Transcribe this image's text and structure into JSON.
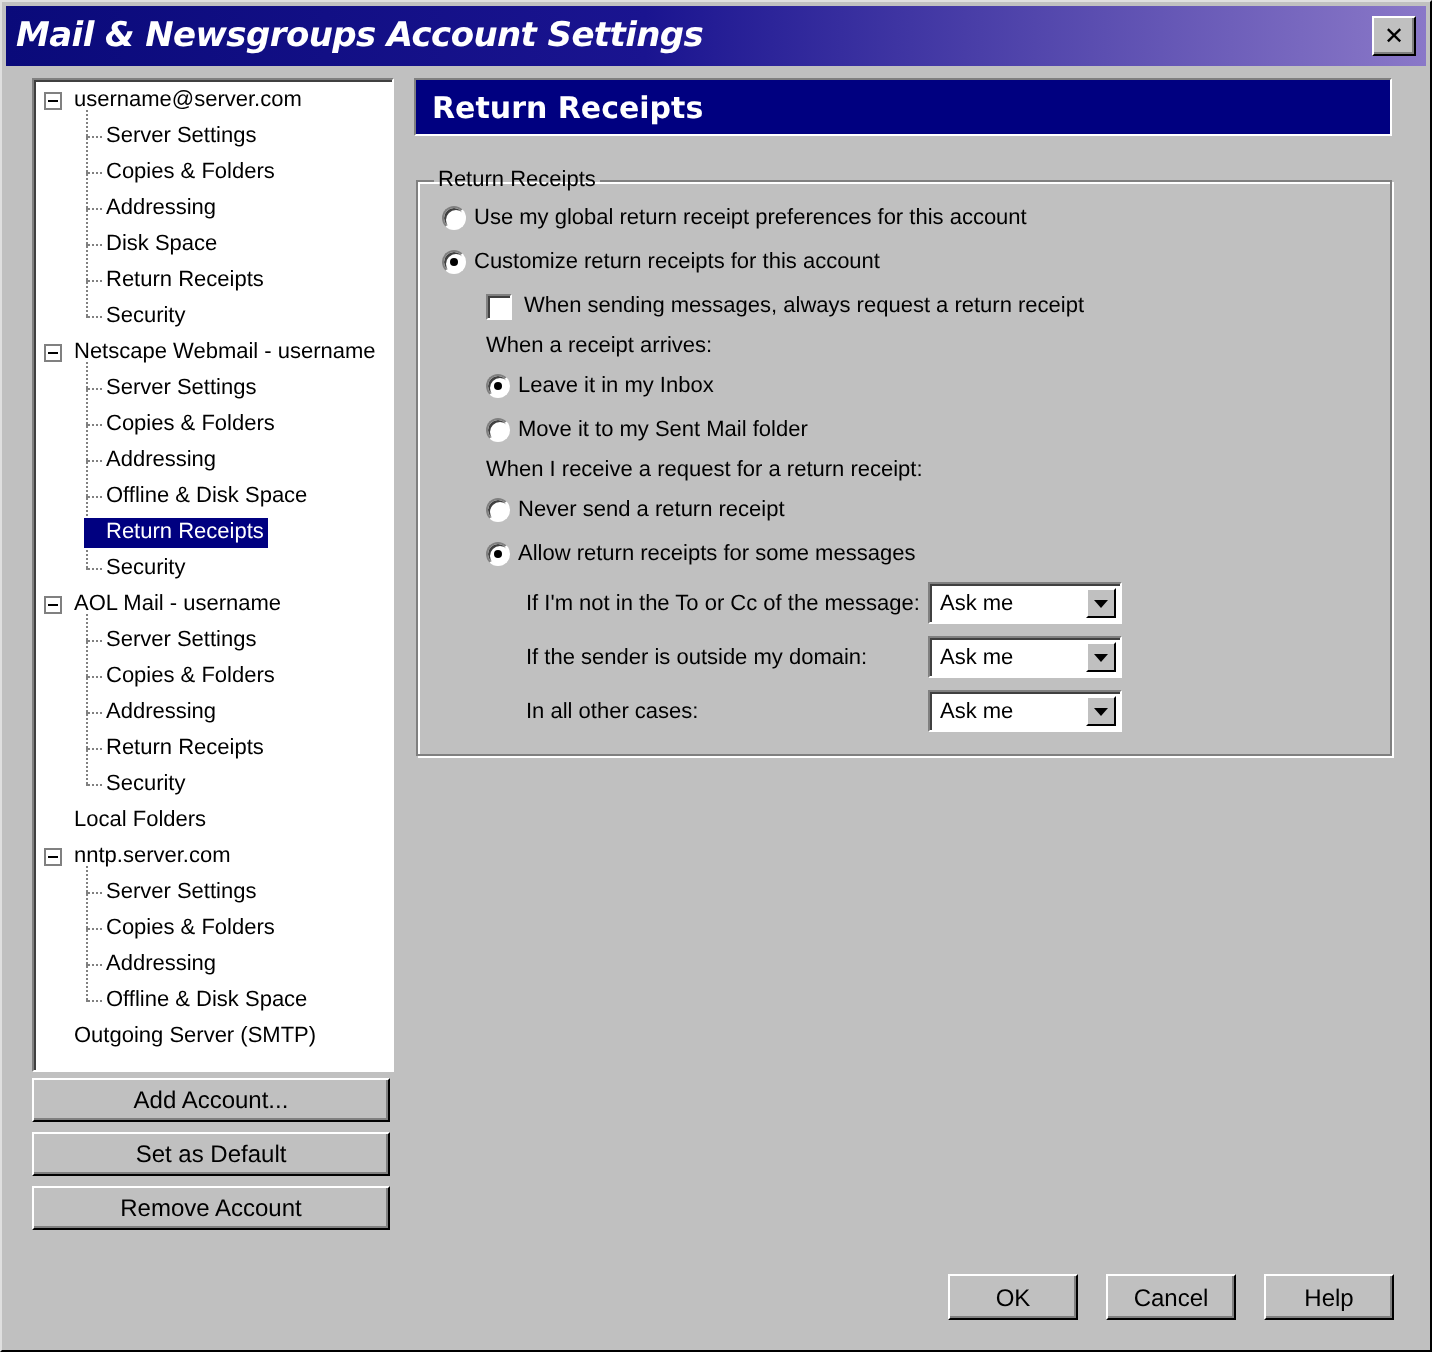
{
  "window": {
    "title": "Mail & Newsgroups Account Settings",
    "close_button": "✕"
  },
  "sidebar": {
    "tree": [
      {
        "label": "username@server.com",
        "expanded": true,
        "selected": false,
        "children": [
          {
            "label": "Server Settings",
            "selected": false
          },
          {
            "label": "Copies & Folders",
            "selected": false
          },
          {
            "label": "Addressing",
            "selected": false
          },
          {
            "label": "Disk Space",
            "selected": false
          },
          {
            "label": "Return Receipts",
            "selected": false
          },
          {
            "label": "Security",
            "selected": false
          }
        ]
      },
      {
        "label": "Netscape Webmail - username",
        "expanded": true,
        "selected": false,
        "children": [
          {
            "label": "Server Settings",
            "selected": false
          },
          {
            "label": "Copies & Folders",
            "selected": false
          },
          {
            "label": "Addressing",
            "selected": false
          },
          {
            "label": "Offline & Disk Space",
            "selected": false
          },
          {
            "label": "Return Receipts",
            "selected": true
          },
          {
            "label": "Security",
            "selected": false
          }
        ]
      },
      {
        "label": "AOL Mail - username",
        "expanded": true,
        "selected": false,
        "children": [
          {
            "label": "Server Settings",
            "selected": false
          },
          {
            "label": "Copies & Folders",
            "selected": false
          },
          {
            "label": "Addressing",
            "selected": false
          },
          {
            "label": "Return Receipts",
            "selected": false
          },
          {
            "label": "Security",
            "selected": false
          }
        ]
      },
      {
        "label": "Local Folders",
        "selected": false
      },
      {
        "label": "nntp.server.com",
        "expanded": true,
        "selected": false,
        "children": [
          {
            "label": "Server Settings",
            "selected": false
          },
          {
            "label": "Copies & Folders",
            "selected": false
          },
          {
            "label": "Addressing",
            "selected": false
          },
          {
            "label": "Offline & Disk Space",
            "selected": false
          }
        ]
      },
      {
        "label": "Outgoing Server (SMTP)",
        "selected": false
      }
    ],
    "buttons": [
      "Add Account...",
      "Set as Default",
      "Remove Account"
    ]
  },
  "panel": {
    "title": "Return Receipts",
    "group": {
      "legend": "Return Receipts",
      "items": [
        {
          "kind": "radio",
          "label": "Use my global return receipt preferences for this account",
          "selected": false
        },
        {
          "kind": "radio",
          "label": "Customize return receipts for this account",
          "selected": true,
          "children": [
            {
              "kind": "checkbox",
              "label": "When sending messages, always request a return receipt",
              "checked": false
            },
            {
              "kind": "heading",
              "label": "When a receipt arrives:"
            },
            {
              "kind": "radio",
              "label": "Leave it in my Inbox",
              "selected": true
            },
            {
              "kind": "radio",
              "label": "Move it to my Sent Mail folder",
              "selected": false
            },
            {
              "kind": "heading",
              "label": "When I receive a request for a return receipt:"
            },
            {
              "kind": "radio",
              "label": "Never send a return receipt",
              "selected": false
            },
            {
              "kind": "radio",
              "label": "Allow return receipts for some messages",
              "selected": true,
              "children": [
                {
                  "kind": "select",
                  "label": "If I'm not in the To or Cc of the message:",
                  "value": "Ask me"
                },
                {
                  "kind": "select",
                  "label": "If the sender is outside my domain:",
                  "value": "Ask me"
                },
                {
                  "kind": "select",
                  "label": "In all other cases:",
                  "value": "Ask me"
                }
              ]
            }
          ]
        }
      ]
    }
  },
  "buttons": [
    "OK",
    "Cancel",
    "Help"
  ]
}
